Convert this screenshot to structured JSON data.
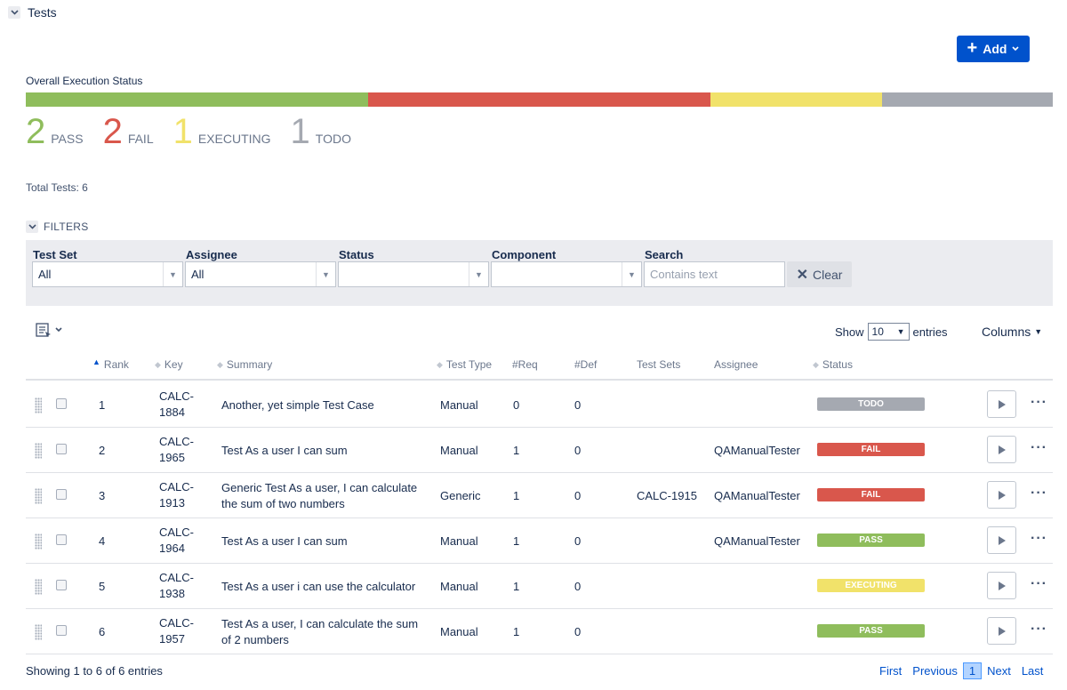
{
  "section": {
    "title": "Tests"
  },
  "add_button": {
    "label": "Add"
  },
  "overall": {
    "label": "Overall Execution Status",
    "segments": [
      {
        "name": "PASS",
        "count": "2",
        "color": "#8fbd5c"
      },
      {
        "name": "FAIL",
        "count": "2",
        "color": "#d9574c"
      },
      {
        "name": "EXECUTING",
        "count": "1",
        "color": "#f1e26a"
      },
      {
        "name": "TODO",
        "count": "1",
        "color": "#a5a9b1"
      }
    ],
    "total": "Total Tests: 6"
  },
  "filters": {
    "toggle_label": "FILTERS",
    "test_set": {
      "label": "Test Set",
      "value": "All"
    },
    "assignee": {
      "label": "Assignee",
      "value": "All"
    },
    "status": {
      "label": "Status",
      "value": ""
    },
    "component": {
      "label": "Component",
      "value": ""
    },
    "search": {
      "label": "Search",
      "placeholder": "Contains text",
      "value": ""
    },
    "clear_label": "Clear"
  },
  "table_controls": {
    "show_label": "Show",
    "entries_value": "10",
    "entries_label": "entries",
    "columns_label": "Columns"
  },
  "columns": {
    "rank": "Rank",
    "key": "Key",
    "summary": "Summary",
    "test_type": "Test Type",
    "req": "#Req",
    "def": "#Def",
    "test_sets": "Test Sets",
    "assignee": "Assignee",
    "status": "Status"
  },
  "rows": [
    {
      "rank": "1",
      "key_line1": "CALC-",
      "key_line2": "1884",
      "summary_line1": "Another, yet simple Test Case",
      "summary_line2": "",
      "type": "Manual",
      "req": "0",
      "def": "0",
      "test_sets": "",
      "assignee": "",
      "status": "TODO",
      "status_color": "#a5a9b1"
    },
    {
      "rank": "2",
      "key_line1": "CALC-",
      "key_line2": "1965",
      "summary_line1": "Test As a user I can sum",
      "summary_line2": "",
      "type": "Manual",
      "req": "1",
      "def": "0",
      "test_sets": "",
      "assignee": "QAManualTester",
      "status": "FAIL",
      "status_color": "#d9574c"
    },
    {
      "rank": "3",
      "key_line1": "CALC-",
      "key_line2": "1913",
      "summary_line1": "Generic Test As a user, I can calculate",
      "summary_line2": "the sum of two numbers",
      "type": "Generic",
      "req": "1",
      "def": "0",
      "test_sets": "CALC-1915",
      "assignee": "QAManualTester",
      "status": "FAIL",
      "status_color": "#d9574c"
    },
    {
      "rank": "4",
      "key_line1": "CALC-",
      "key_line2": "1964",
      "summary_line1": "Test As a user I can sum",
      "summary_line2": "",
      "type": "Manual",
      "req": "1",
      "def": "0",
      "test_sets": "",
      "assignee": "QAManualTester",
      "status": "PASS",
      "status_color": "#8fbd5c"
    },
    {
      "rank": "5",
      "key_line1": "CALC-",
      "key_line2": "1938",
      "summary_line1": "Test As a user i can use the calculator",
      "summary_line2": "",
      "type": "Manual",
      "req": "1",
      "def": "0",
      "test_sets": "",
      "assignee": "",
      "status": "EXECUTING",
      "status_color": "#f1e26a"
    },
    {
      "rank": "6",
      "key_line1": "CALC-",
      "key_line2": "1957",
      "summary_line1": "Test As a user, I can calculate the sum",
      "summary_line2": "of 2 numbers",
      "type": "Manual",
      "req": "1",
      "def": "0",
      "test_sets": "",
      "assignee": "",
      "status": "PASS",
      "status_color": "#8fbd5c"
    }
  ],
  "footer": {
    "info": "Showing 1 to 6 of 6 entries",
    "first": "First",
    "previous": "Previous",
    "current_page": "1",
    "next": "Next",
    "last": "Last"
  }
}
